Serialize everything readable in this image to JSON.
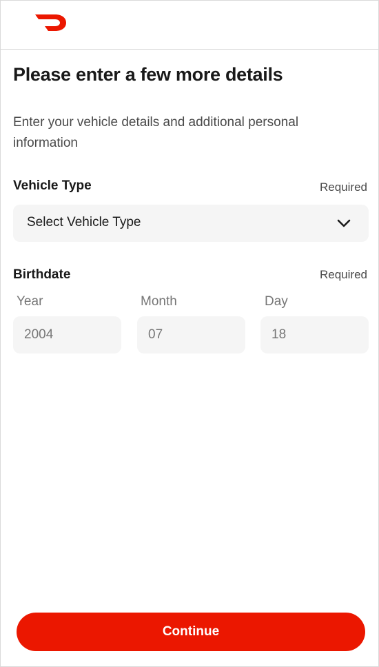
{
  "brand": {
    "logo_icon": "doordash-logo-icon",
    "accent_color": "#eb1700"
  },
  "header": {
    "title": "Please enter a few more details",
    "subtitle": "Enter your vehicle details and additional personal information"
  },
  "vehicle": {
    "label": "Vehicle Type",
    "required_text": "Required",
    "select_value": "Select Vehicle Type",
    "chevron_icon": "chevron-down-icon"
  },
  "birthdate": {
    "label": "Birthdate",
    "required_text": "Required",
    "year": {
      "label": "Year",
      "value": "2004"
    },
    "month": {
      "label": "Month",
      "value": "07"
    },
    "day": {
      "label": "Day",
      "value": "18"
    }
  },
  "actions": {
    "continue_label": "Continue"
  }
}
